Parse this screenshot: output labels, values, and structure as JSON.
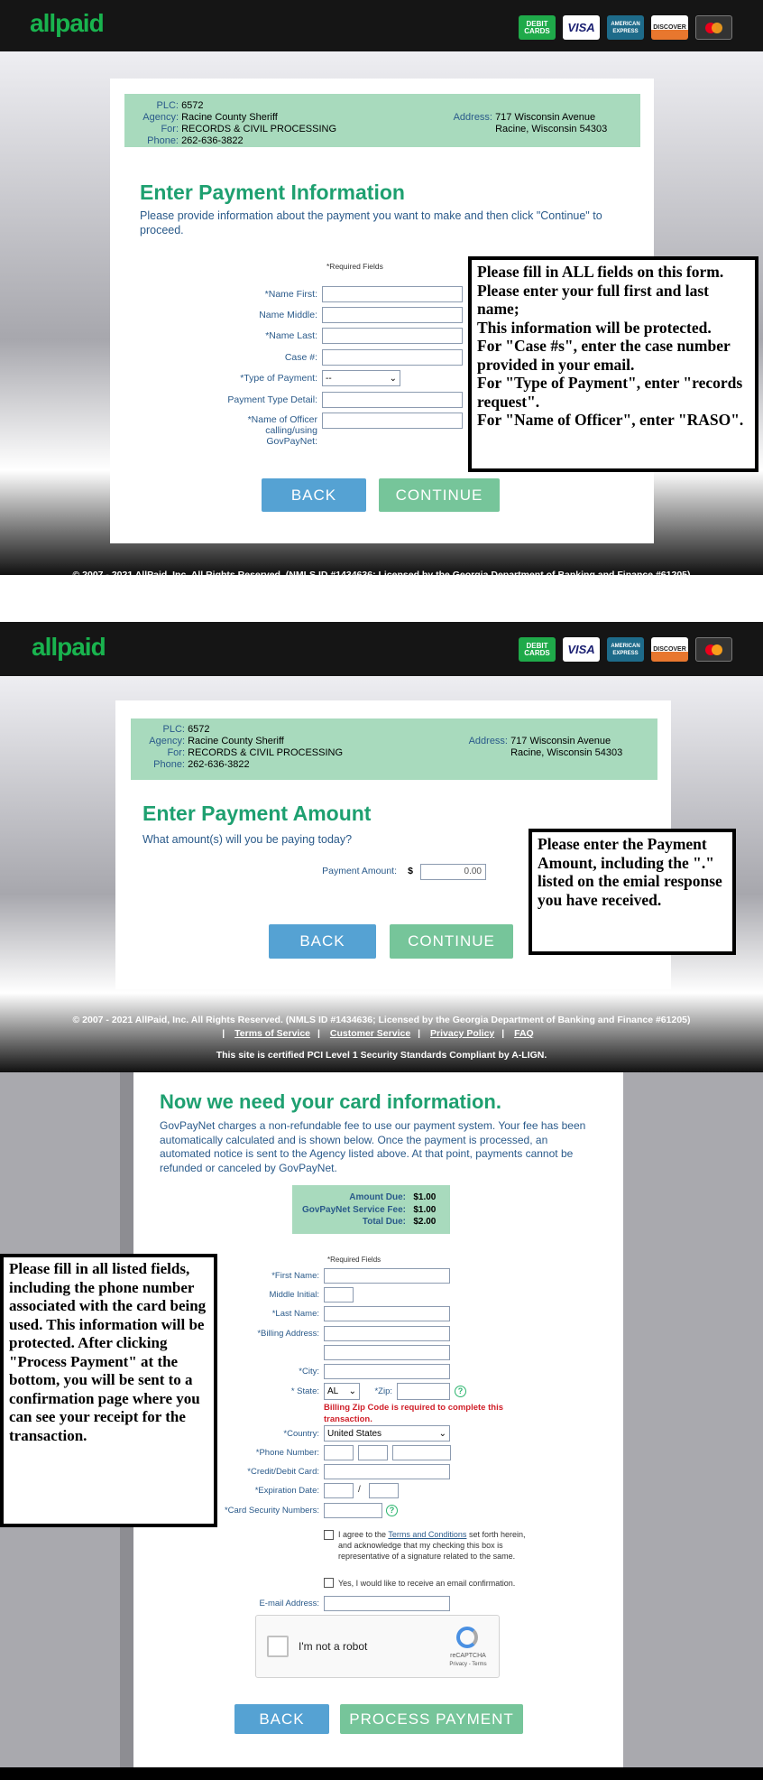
{
  "brand": {
    "logo": "allpaid",
    "cards": [
      "DEBIT CARDS",
      "VISA",
      "AMERICAN EXPRESS",
      "DISCOVER",
      "mastercard-icon"
    ]
  },
  "agency": {
    "plc_label": "PLC:",
    "plc": "6572",
    "agency_label": "Agency:",
    "agency": "Racine County Sheriff",
    "for_label": "For:",
    "for": "RECORDS & CIVIL PROCESSING",
    "phone_label": "Phone:",
    "phone": "262-636-3822",
    "address_label": "Address:",
    "address1": "717 Wisconsin Avenue",
    "address2": "Racine, Wisconsin 54303"
  },
  "step1": {
    "title": "Enter Payment Information",
    "desc": "Please provide information about the payment you want to make and then click \"Continue\" to proceed.",
    "required": "*Required Fields",
    "fields": [
      {
        "label": "*Name First:"
      },
      {
        "label": "Name Middle:"
      },
      {
        "label": "*Name Last:"
      },
      {
        "label": "Case #:"
      },
      {
        "label": "*Type of Payment:",
        "value": "--"
      },
      {
        "label": "Payment Type Detail:"
      },
      {
        "label": "*Name of Officer calling/using GovPayNet:"
      }
    ],
    "note": [
      "Please fill in ALL fields on this form.",
      "Please enter your full first and last name;",
      "This information will be protected.",
      "For \"Case #s\", enter the case number provided in your email.",
      "For \"Type of Payment\", enter \"records request\".",
      "For \"Name of Officer\", enter \"RASO\"."
    ],
    "back": "BACK",
    "continue": "CONTINUE"
  },
  "footer": {
    "copyright": "© 2007 - 2021 AllPaid, Inc. All Rights Reserved. (NMLS ID #1434636; Licensed by the Georgia Department of Banking and Finance #61205)",
    "links": [
      "Terms of Service",
      "Customer Service",
      "Privacy Policy",
      "FAQ"
    ],
    "pci": "This site is certified PCI Level 1 Security Standards Compliant by A-LIGN."
  },
  "step2": {
    "title": "Enter Payment Amount",
    "desc": "What amount(s) will you be paying today?",
    "amount_label": "Payment Amount:",
    "currency": "$",
    "amount": "0.00",
    "note": "Please enter the Payment Amount, including the \".\" listed on the emial response you have received.",
    "back": "BACK",
    "continue": "CONTINUE"
  },
  "step3": {
    "title": "Now we need your card information.",
    "desc": "GovPayNet charges a non-refundable fee to use our payment system. Your fee has been automatically calculated and is shown below. Once the payment is processed, an automated notice is sent to the Agency listed above. At that point, payments cannot be refunded or canceled by GovPayNet.",
    "amount_due_label": "Amount Due:",
    "amount_due": "$1.00",
    "fee_label": "GovPayNet Service Fee:",
    "fee": "$1.00",
    "total_label": "Total Due:",
    "total": "$2.00",
    "required": "*Required Fields",
    "first": "*First Name:",
    "middle": "Middle Initial:",
    "last": "*Last Name:",
    "address": "*Billing Address:",
    "city": "*City:",
    "state": "* State:",
    "state_value": "AL",
    "zip": "*Zip:",
    "zip_error": "Billing Zip Code is required to complete this transaction.",
    "country": "*Country:",
    "country_value": "United States",
    "phone": "*Phone Number:",
    "card": "*Credit/Debit Card:",
    "exp": "*Expiration Date:",
    "exp_sep": "/",
    "csc": "*Card Security Numbers:",
    "agree_pre": "I agree to the ",
    "agree_link": "Terms and Conditions",
    "agree_post": " set forth herein, and acknowledge that my checking this box is representative of a signature related to the same.",
    "email_confirm": "Yes, I would like to receive an email confirmation.",
    "email": "E-mail Address:",
    "captcha": "I'm not a robot",
    "captcha_brand": "reCAPTCHA",
    "captcha_links": "Privacy - Terms",
    "note": "Please fill in all listed fields, including the phone number associated with the card being used. This information will be protected. After clicking \"Process Payment\" at the bottom, you will be sent to a confirmation page where you can see your receipt for the transaction.",
    "back": "BACK",
    "process": "PROCESS PAYMENT"
  },
  "colors": {
    "green": "#1ea070",
    "blue_label": "#2a5a8a",
    "info_bg": "#a8dabd",
    "back_btn": "#55a2d3",
    "continue_btn": "#76c59a",
    "error": "#d0202a"
  }
}
